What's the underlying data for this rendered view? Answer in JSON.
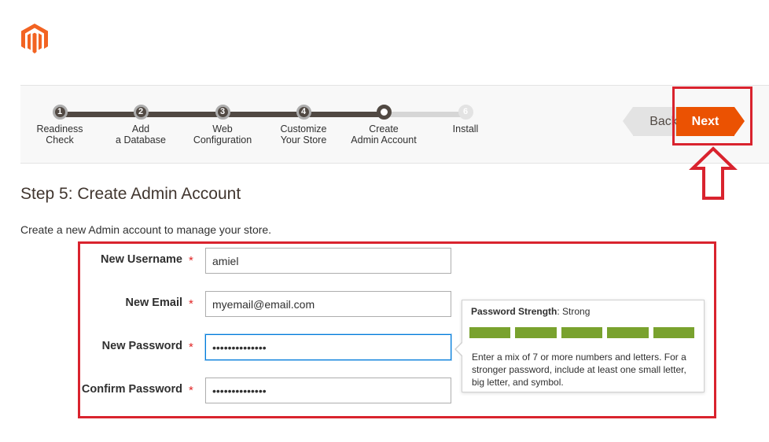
{
  "brand": {
    "logo_icon": "magento-logo-icon",
    "accent": "#eb5202"
  },
  "steps": [
    {
      "number": "1",
      "label": "Readiness\nCheck",
      "state": "done"
    },
    {
      "number": "2",
      "label": "Add\na Database",
      "state": "done"
    },
    {
      "number": "3",
      "label": "Web\nConfiguration",
      "state": "done"
    },
    {
      "number": "4",
      "label": "Customize\nYour Store",
      "state": "done"
    },
    {
      "number": "",
      "label": "Create\nAdmin Account",
      "state": "current"
    },
    {
      "number": "6",
      "label": "Install",
      "state": "pending"
    }
  ],
  "nav": {
    "back_label": "Back",
    "next_label": "Next"
  },
  "page": {
    "title": "Step 5: Create Admin Account",
    "intro": "Create a new Admin account to manage your store."
  },
  "form": {
    "required_marker": "*",
    "fields": [
      {
        "label": "New Username",
        "value": "amiel",
        "type": "text"
      },
      {
        "label": "New Email",
        "value": "myemail@email.com",
        "type": "text"
      },
      {
        "label": "New Password",
        "value": "••••••••••••••",
        "type": "password"
      },
      {
        "label": "Confirm Password",
        "value": "••••••••••••••",
        "type": "password"
      }
    ]
  },
  "password_tooltip": {
    "heading": "Password Strength",
    "strength": ": Strong",
    "strength_level": 5,
    "strength_max": 5,
    "meter_color": "#79a22e",
    "help": "Enter a mix of 7 or more numbers and letters. For a stronger password, include at least one small letter, big letter, and symbol."
  },
  "annotations": {
    "highlight_color": "#d9232e"
  }
}
